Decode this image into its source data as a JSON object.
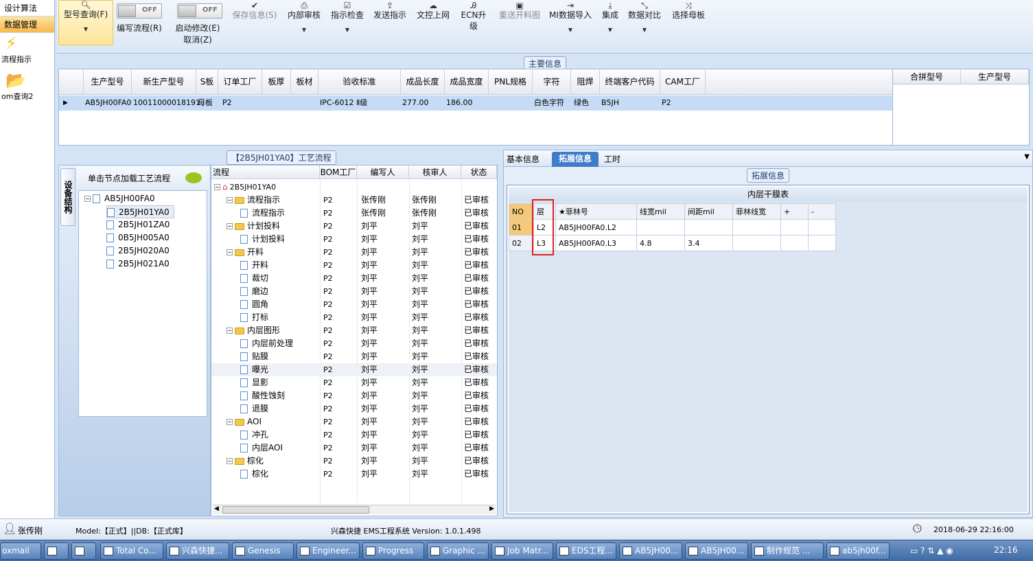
{
  "left_nav": {
    "tab1": "设计算法",
    "tab2": "数据管理",
    "item1": "流程指示",
    "item2": "om查询2"
  },
  "toolbar": {
    "btn_query": "型号查询(F)",
    "btn_edit_flow": "编写流程(R)",
    "btn_start_modify": "启动修改(E)",
    "btn_cancel": "取消(Z)",
    "toggle_off": "OFF",
    "btn_save": "保存信息(S)",
    "btn_internal_audit": "内部审核",
    "btn_instr_check": "指示检查",
    "btn_send": "发送指示",
    "btn_upload": "文控上网",
    "btn_ecn": "ECN升级",
    "btn_resend": "重送开料图",
    "btn_mi_import": "MI数据导入",
    "btn_integrate": "集成",
    "btn_compare": "数据对比",
    "btn_select_mother": "选择母板"
  },
  "main_info": {
    "title": "主要信息",
    "headers": [
      "生产型号",
      "新生产型号",
      "S板",
      "订单工厂",
      "板厚",
      "板材",
      "验收标准",
      "成品长度",
      "成品宽度",
      "PNL规格",
      "字符",
      "阻焊",
      "终端客户代码",
      "CAM工厂"
    ],
    "row": [
      "AB5JH00FA0",
      "10011000018191",
      "母板",
      "P2",
      "",
      "",
      "IPC-6012 Ⅱ级",
      "277.00",
      "186.00",
      "",
      "白色字符",
      "绿色",
      "B5JH",
      "P2"
    ],
    "side_headers": [
      "合拼型号",
      "生产型号"
    ]
  },
  "left_tree": {
    "vertical_tab": "设备结构",
    "load_hint": "单击节点加载工艺流程",
    "root": "AB5JH00FA0",
    "children": [
      "2B5JH01YA0",
      "2B5JH01ZA0",
      "0B5JH005A0",
      "2B5JH020A0",
      "2B5JH021A0"
    ]
  },
  "process": {
    "title": "【2B5JH01YA0】工艺流程",
    "headers": [
      "流程",
      "BOM工厂",
      "编写人",
      "核审人",
      "状态"
    ],
    "root": "2B5JH01YA0",
    "rows": [
      {
        "name": "流程指示",
        "level": 1,
        "bom": "P2",
        "writer": "张传刚",
        "reviewer": "张传刚",
        "status": "已审核"
      },
      {
        "name": "流程指示",
        "level": 2,
        "bom": "P2",
        "writer": "张传刚",
        "reviewer": "张传刚",
        "status": "已审核"
      },
      {
        "name": "计划投料",
        "level": 1,
        "bom": "P2",
        "writer": "刘平",
        "reviewer": "刘平",
        "status": "已审核"
      },
      {
        "name": "计划投料",
        "level": 2,
        "bom": "P2",
        "writer": "刘平",
        "reviewer": "刘平",
        "status": "已审核"
      },
      {
        "name": "开料",
        "level": 1,
        "bom": "P2",
        "writer": "刘平",
        "reviewer": "刘平",
        "status": "已审核"
      },
      {
        "name": "开料",
        "level": 2,
        "bom": "P2",
        "writer": "刘平",
        "reviewer": "刘平",
        "status": "已审核"
      },
      {
        "name": "裁切",
        "level": 2,
        "bom": "P2",
        "writer": "刘平",
        "reviewer": "刘平",
        "status": "已审核"
      },
      {
        "name": "磨边",
        "level": 2,
        "bom": "P2",
        "writer": "刘平",
        "reviewer": "刘平",
        "status": "已审核"
      },
      {
        "name": "圆角",
        "level": 2,
        "bom": "P2",
        "writer": "刘平",
        "reviewer": "刘平",
        "status": "已审核"
      },
      {
        "name": "打标",
        "level": 2,
        "bom": "P2",
        "writer": "刘平",
        "reviewer": "刘平",
        "status": "已审核"
      },
      {
        "name": "内层图形",
        "level": 1,
        "bom": "P2",
        "writer": "刘平",
        "reviewer": "刘平",
        "status": "已审核"
      },
      {
        "name": "内层前处理",
        "level": 2,
        "bom": "P2",
        "writer": "刘平",
        "reviewer": "刘平",
        "status": "已审核"
      },
      {
        "name": "贴膜",
        "level": 2,
        "bom": "P2",
        "writer": "刘平",
        "reviewer": "刘平",
        "status": "已审核"
      },
      {
        "name": "曝光",
        "level": 2,
        "bom": "P2",
        "writer": "刘平",
        "reviewer": "刘平",
        "status": "已审核"
      },
      {
        "name": "显影",
        "level": 2,
        "bom": "P2",
        "writer": "刘平",
        "reviewer": "刘平",
        "status": "已审核"
      },
      {
        "name": "酸性蚀刻",
        "level": 2,
        "bom": "P2",
        "writer": "刘平",
        "reviewer": "刘平",
        "status": "已审核"
      },
      {
        "name": "退膜",
        "level": 2,
        "bom": "P2",
        "writer": "刘平",
        "reviewer": "刘平",
        "status": "已审核"
      },
      {
        "name": "AOI",
        "level": 1,
        "bom": "P2",
        "writer": "刘平",
        "reviewer": "刘平",
        "status": "已审核"
      },
      {
        "name": "冲孔",
        "level": 2,
        "bom": "P2",
        "writer": "刘平",
        "reviewer": "刘平",
        "status": "已审核"
      },
      {
        "name": "内层AOI",
        "level": 2,
        "bom": "P2",
        "writer": "刘平",
        "reviewer": "刘平",
        "status": "已审核"
      },
      {
        "name": "棕化",
        "level": 1,
        "bom": "P2",
        "writer": "刘平",
        "reviewer": "刘平",
        "status": "已审核"
      },
      {
        "name": "棕化",
        "level": 2,
        "bom": "P2",
        "writer": "刘平",
        "reviewer": "刘平",
        "status": "已审核"
      }
    ]
  },
  "right": {
    "tabs": [
      "基本信息",
      "拓展信息",
      "工时"
    ],
    "group_title": "拓展信息",
    "table_title": "内层干膜表",
    "headers": [
      "NO",
      "层",
      "★菲林号",
      "线宽mil",
      "间距mil",
      "菲林线宽",
      "+",
      "-"
    ],
    "rows": [
      [
        "01",
        "L2",
        "AB5JH00FA0.L2",
        "",
        "",
        "",
        "",
        ""
      ],
      [
        "02",
        "L3",
        "AB5JH00FA0.L3",
        "4.8",
        "3.4",
        "",
        "",
        ""
      ]
    ]
  },
  "status": {
    "user": "张传刚",
    "model": "Model:【正式】||DB:【正式库】",
    "system": "兴森快捷  EMS工程系统  Version: 1.0.1.498",
    "datetime": "2018-06-29 22:16:00"
  },
  "taskbar": {
    "start": "oxmail",
    "tasks": [
      "Total Co...",
      "兴森快捷...",
      "Genesis",
      "Engineer...",
      "Progress",
      "Graphic ...",
      "Job Matr...",
      "EDS工程...",
      "AB5JH00...",
      "AB5JH00...",
      "制作规范 ...",
      "ab5jh00f..."
    ],
    "clock": "22:16"
  }
}
